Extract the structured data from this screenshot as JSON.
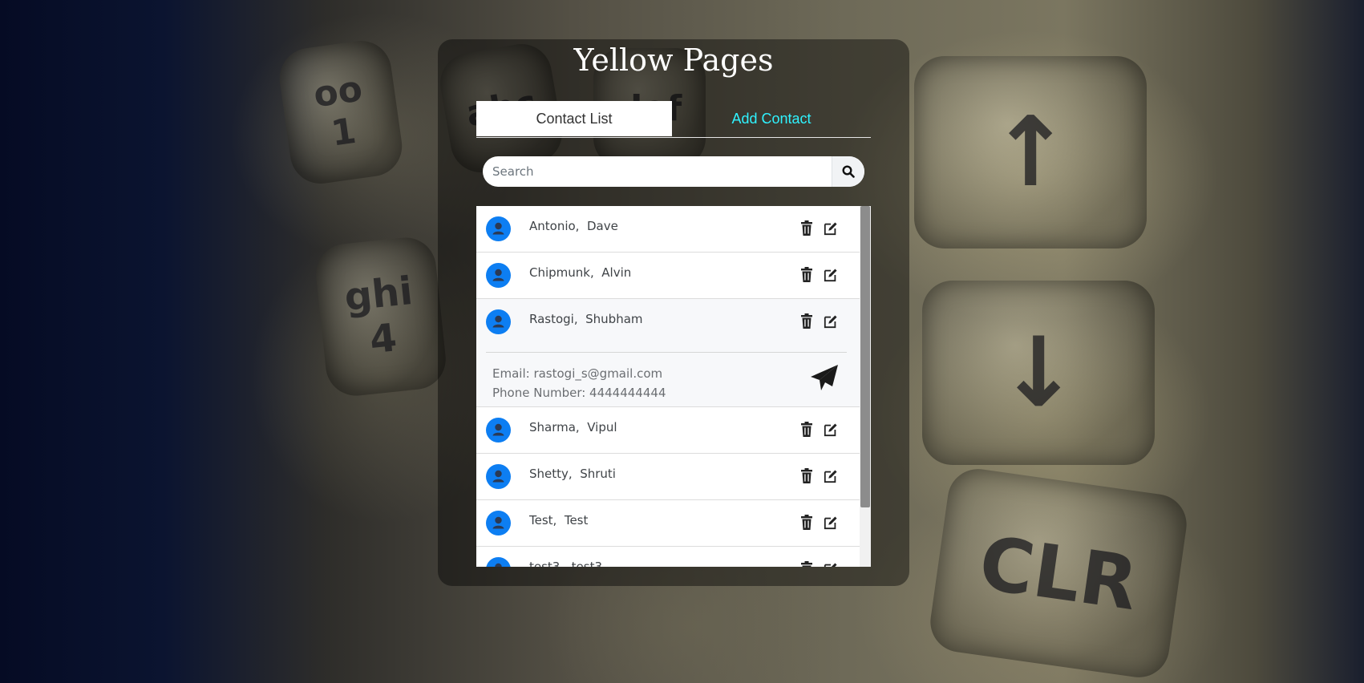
{
  "app": {
    "title": "Yellow Pages"
  },
  "tabs": [
    {
      "label": "Contact List",
      "active": true
    },
    {
      "label": "Add Contact",
      "active": false
    }
  ],
  "search": {
    "placeholder": "Search",
    "value": ""
  },
  "contacts": [
    {
      "name": "Antonio,  Dave"
    },
    {
      "name": "Chipmunk,  Alvin"
    },
    {
      "name": "Rastogi,  Shubham",
      "expanded": true,
      "email": "Email: rastogi_s@gmail.com",
      "phone": "Phone Number: 4444444444"
    },
    {
      "name": "Sharma,  Vipul"
    },
    {
      "name": "Shetty,  Shruti"
    },
    {
      "name": "Test,  Test"
    },
    {
      "name": "test3,  test3"
    }
  ],
  "background_keys": [
    {
      "label": "oo\n1"
    },
    {
      "label": "abc"
    },
    {
      "label": "def"
    },
    {
      "label": "ghi\n4"
    },
    {
      "label": "↑"
    },
    {
      "label": "↓"
    },
    {
      "label": "CLR"
    }
  ],
  "colors": {
    "accent": "#0d7ef2",
    "inactive_tab": "#2ff3ff",
    "panel": "rgba(0,0,0,0.42)"
  },
  "icons": {
    "delete": "trash-icon",
    "edit": "edit-icon",
    "search": "search-icon",
    "send": "paper-plane-icon",
    "avatar": "user-icon"
  }
}
